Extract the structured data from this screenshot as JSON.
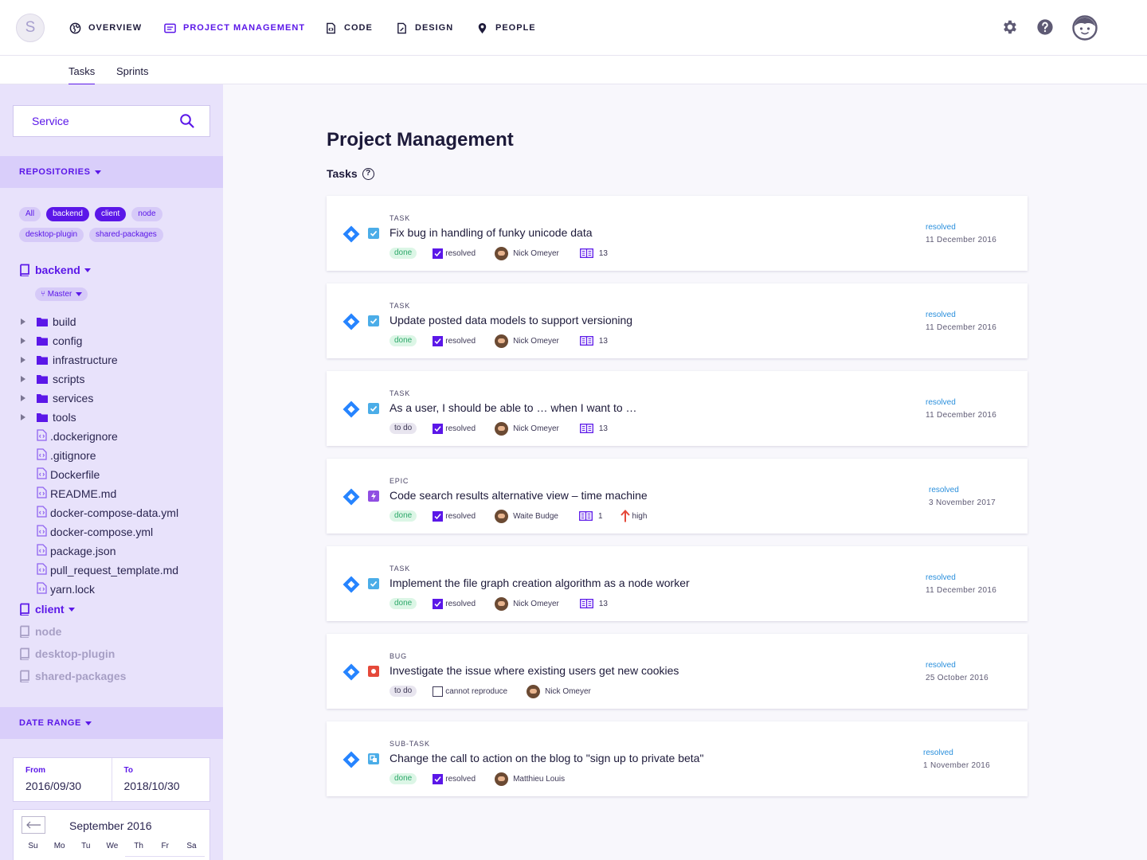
{
  "app": {
    "logo_letter": "S"
  },
  "nav": [
    {
      "label": "OVERVIEW",
      "icon": "globe-icon",
      "active": false
    },
    {
      "label": "PROJECT MANAGEMENT",
      "icon": "project-board-icon",
      "active": true
    },
    {
      "label": "CODE",
      "icon": "code-file-icon",
      "active": false
    },
    {
      "label": "DESIGN",
      "icon": "design-file-icon",
      "active": false
    },
    {
      "label": "PEOPLE",
      "icon": "location-pin-icon",
      "active": false
    }
  ],
  "top_icons": [
    "gear-icon",
    "help-icon",
    "user-avatar-icon"
  ],
  "subtabs": [
    {
      "label": "Tasks",
      "active": true
    },
    {
      "label": "Sprints",
      "active": false
    }
  ],
  "sidebar": {
    "search_value": "Service",
    "repositories_label": "REPOSITORIES",
    "chips": [
      {
        "label": "All",
        "on": false
      },
      {
        "label": "backend",
        "on": true
      },
      {
        "label": "client",
        "on": true
      },
      {
        "label": "node",
        "on": false
      },
      {
        "label": "desktop-plugin",
        "on": false
      },
      {
        "label": "shared-packages",
        "on": false
      }
    ],
    "repo_backend": "backend",
    "branch": "Master",
    "folders": [
      "build",
      "config",
      "infrastructure",
      "scripts",
      "services",
      "tools"
    ],
    "files": [
      ".dockerignore",
      ".gitignore",
      "Dockerfile",
      "README.md",
      "docker-compose-data.yml",
      "docker-compose.yml",
      "package.json",
      "pull_request_template.md",
      "yarn.lock"
    ],
    "repo_client": "client",
    "repos_dim": [
      "node",
      "desktop-plugin",
      "shared-packages"
    ],
    "date_range_label": "DATE RANGE",
    "from_label": "From",
    "from_value": "2016/09/30",
    "to_label": "To",
    "to_value": "2018/10/30",
    "calendar_month": "September 2016",
    "weekdays": [
      "Su",
      "Mo",
      "Tu",
      "We",
      "Th",
      "Fr",
      "Sa"
    ]
  },
  "main": {
    "title": "Project Management",
    "tasks_label": "Tasks",
    "help_glyph": "?",
    "colors": {
      "accent": "#5b17e8",
      "done": "#2ea86a",
      "resolved": "#2a8fdc",
      "diamond": "#2684ff",
      "task_icon": "#4bade8",
      "epic_icon": "#904ee2",
      "bug_icon": "#e5493a",
      "priority_high": "#e5493a"
    },
    "tasks": [
      {
        "type": "TASK",
        "type_icon": "task-check-icon",
        "title": "Fix bug in handling of funky unicode data",
        "status": "done",
        "resolution": "resolved",
        "resolution_checked": true,
        "assignee": "Nick Omeyer",
        "count": "13",
        "priority": "",
        "right_status": "resolved",
        "right_date": "11 December 2016"
      },
      {
        "type": "TASK",
        "type_icon": "task-check-icon",
        "title": "Update posted data models to support versioning",
        "status": "done",
        "resolution": "resolved",
        "resolution_checked": true,
        "assignee": "Nick Omeyer",
        "count": "13",
        "priority": "",
        "right_status": "resolved",
        "right_date": "11 December 2016"
      },
      {
        "type": "TASK",
        "type_icon": "task-check-icon",
        "title": "As a user, I should be able to … when I want to …",
        "status": "to do",
        "resolution": "resolved",
        "resolution_checked": true,
        "assignee": "Nick Omeyer",
        "count": "13",
        "priority": "",
        "right_status": "resolved",
        "right_date": "11 December 2016"
      },
      {
        "type": "EPIC",
        "type_icon": "epic-bolt-icon",
        "title": "Code search results alternative view – time machine",
        "status": "done",
        "resolution": "resolved",
        "resolution_checked": true,
        "assignee": "Waite Budge",
        "count": "1",
        "priority": "high",
        "right_status": "resolved",
        "right_date": "3 November 2017"
      },
      {
        "type": "TASK",
        "type_icon": "task-check-icon",
        "title": "Implement the file graph creation algorithm as a node worker",
        "status": "done",
        "resolution": "resolved",
        "resolution_checked": true,
        "assignee": "Nick Omeyer",
        "count": "13",
        "priority": "",
        "right_status": "resolved",
        "right_date": "11 December 2016"
      },
      {
        "type": "BUG",
        "type_icon": "bug-icon",
        "title": "Investigate the issue where existing users get new cookies",
        "status": "to do",
        "resolution": "cannot reproduce",
        "resolution_checked": false,
        "assignee": "Nick Omeyer",
        "count": "",
        "priority": "",
        "right_status": "resolved",
        "right_date": "25 October 2016"
      },
      {
        "type": "SUB-TASK",
        "type_icon": "subtask-icon",
        "title": "Change the call to action on the blog to \"sign up to private beta\"",
        "status": "done",
        "resolution": "resolved",
        "resolution_checked": true,
        "assignee": "Matthieu Louis",
        "count": "",
        "priority": "",
        "right_status": "resolved",
        "right_date": "1 November 2016"
      }
    ]
  }
}
